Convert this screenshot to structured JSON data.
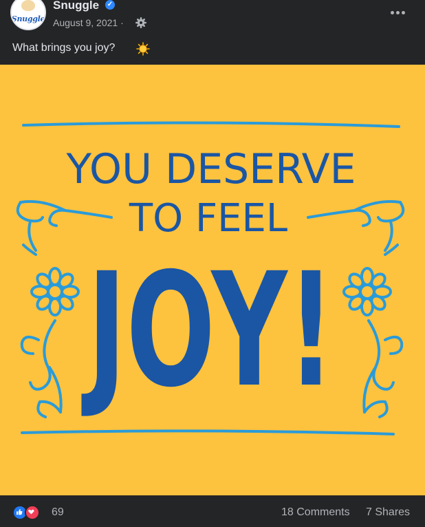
{
  "header": {
    "page_name": "Snuggle",
    "avatar_logo_text": "Snuggle",
    "date": "August 9, 2021 ·",
    "icons": {
      "verified": "verified-badge-icon",
      "audience": "settings-gear-icon",
      "more": "more-options-icon"
    }
  },
  "post": {
    "text": "What brings you joy?",
    "emoji": "sun-emoji"
  },
  "image": {
    "line1": "YOU DESERVE",
    "line2": "TO FEEL",
    "line3": "JOY!",
    "background_color": "#fdc23e",
    "ink_color": "#1a56a4",
    "accent_color": "#2a9bd9"
  },
  "footer": {
    "reaction_count": "69",
    "comments": "18 Comments",
    "shares": "7 Shares",
    "icons": [
      "like-reaction-icon",
      "love-reaction-icon"
    ]
  }
}
